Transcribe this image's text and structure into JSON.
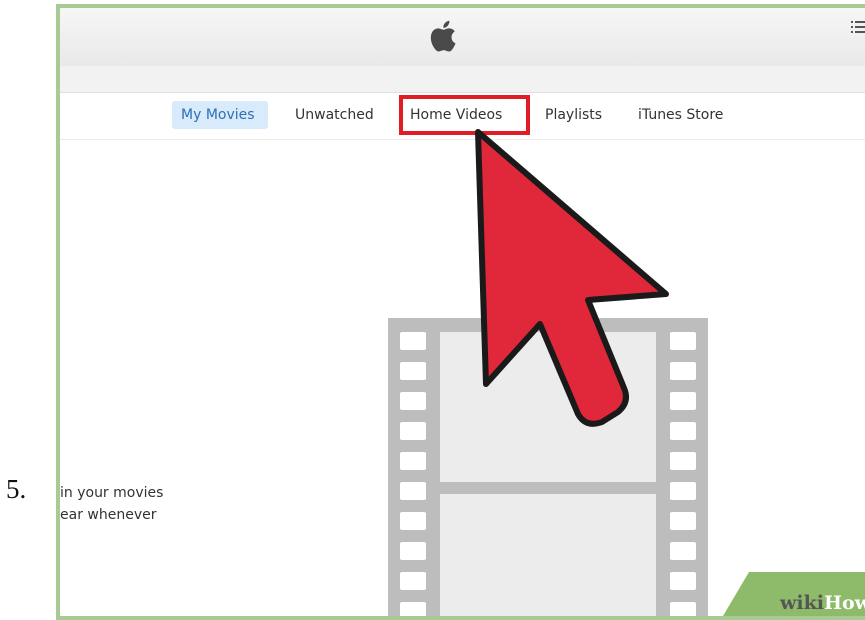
{
  "step": {
    "number": "5."
  },
  "titlebar": {
    "logo_icon": "apple-logo-icon",
    "menu_icon": "list-view-icon"
  },
  "tabs": [
    {
      "label": "My Movies",
      "selected": true
    },
    {
      "label": "Unwatched"
    },
    {
      "label": "Home Videos",
      "highlighted": true
    },
    {
      "label": "Playlists"
    },
    {
      "label": "iTunes Store"
    }
  ],
  "content": {
    "description_lines": [
      "in your movies",
      "ear whenever"
    ],
    "illustration_icon": "film-strip-icon"
  },
  "annotation": {
    "pointer_icon": "red-cursor-arrow-icon",
    "highlight_color": "#e01d25"
  },
  "watermark": {
    "part1": "wiki",
    "part2": "How"
  }
}
